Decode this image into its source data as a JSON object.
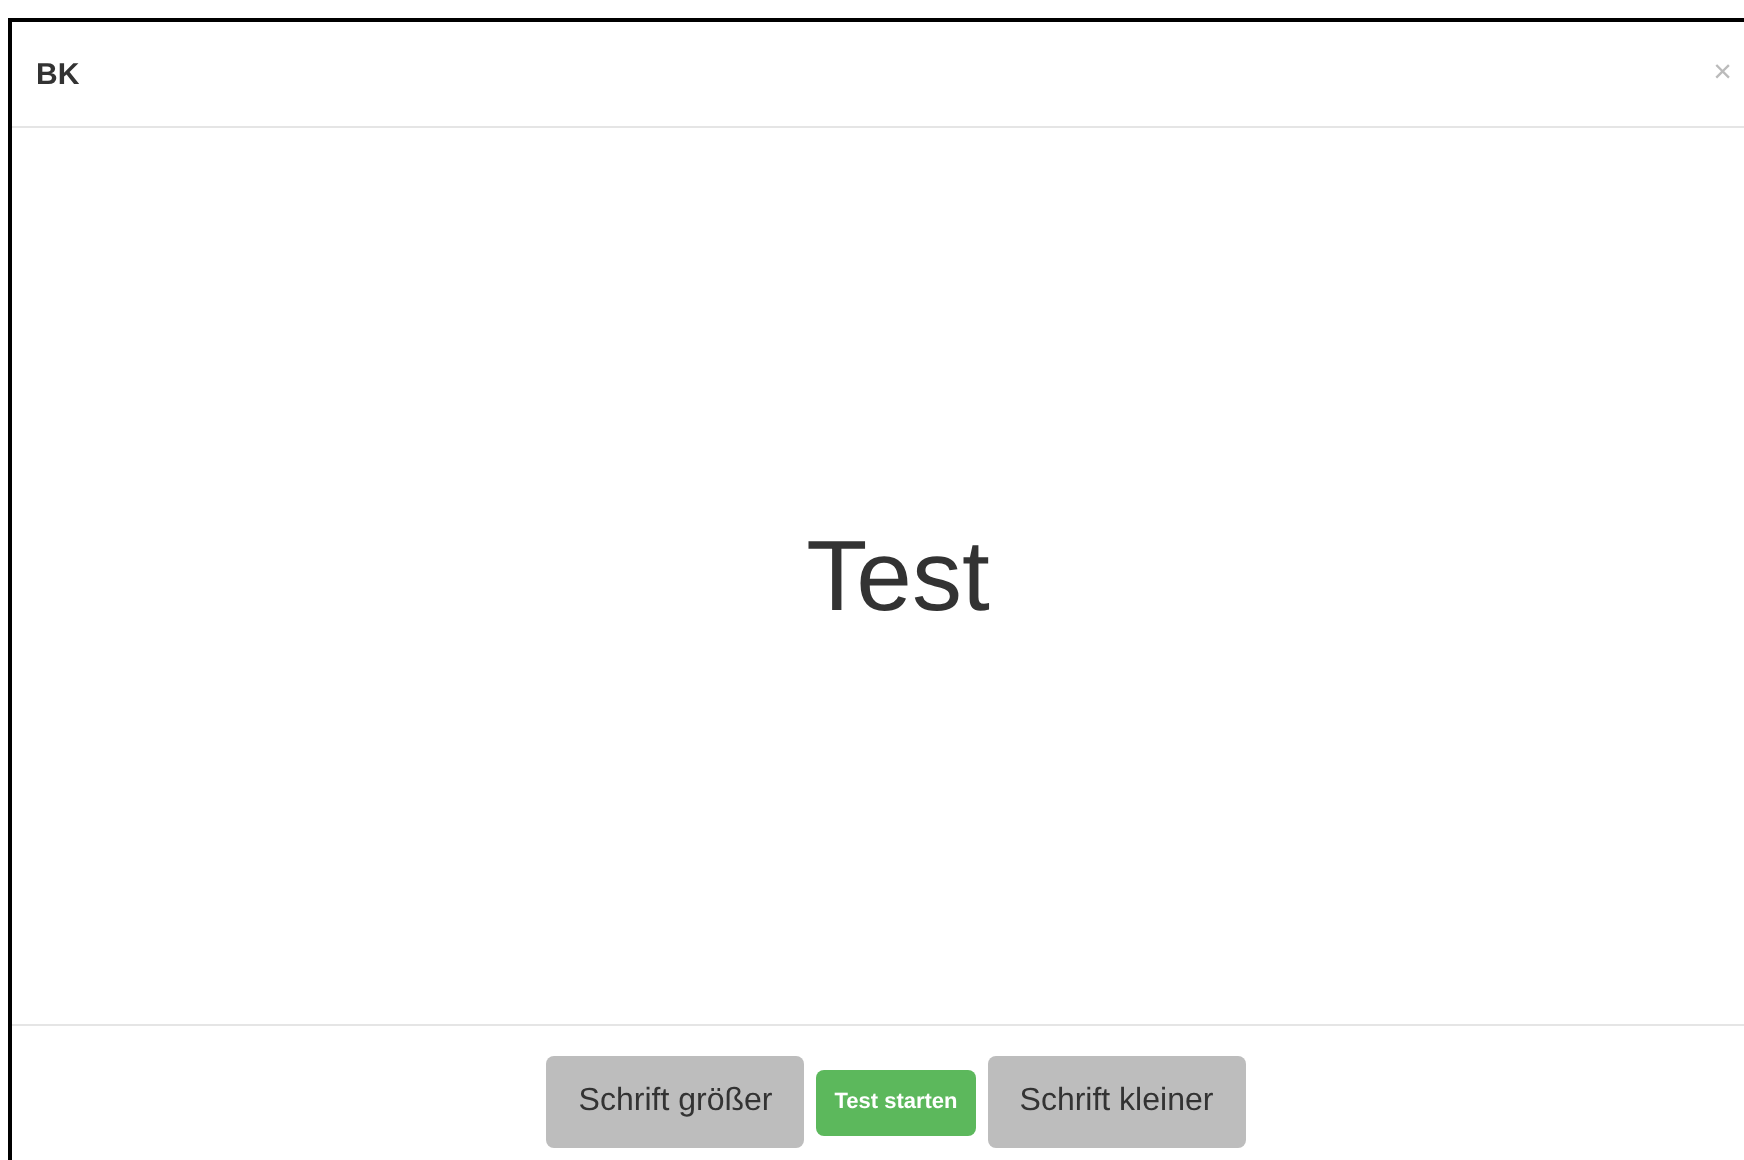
{
  "dialog": {
    "title": "BK",
    "close": "×"
  },
  "body": {
    "text": "Test"
  },
  "buttons": [
    {
      "label": "Schrift größer",
      "kind": "default"
    },
    {
      "label": "Test starten",
      "kind": "primary"
    },
    {
      "label": "Schrift kleiner",
      "kind": "default"
    }
  ]
}
